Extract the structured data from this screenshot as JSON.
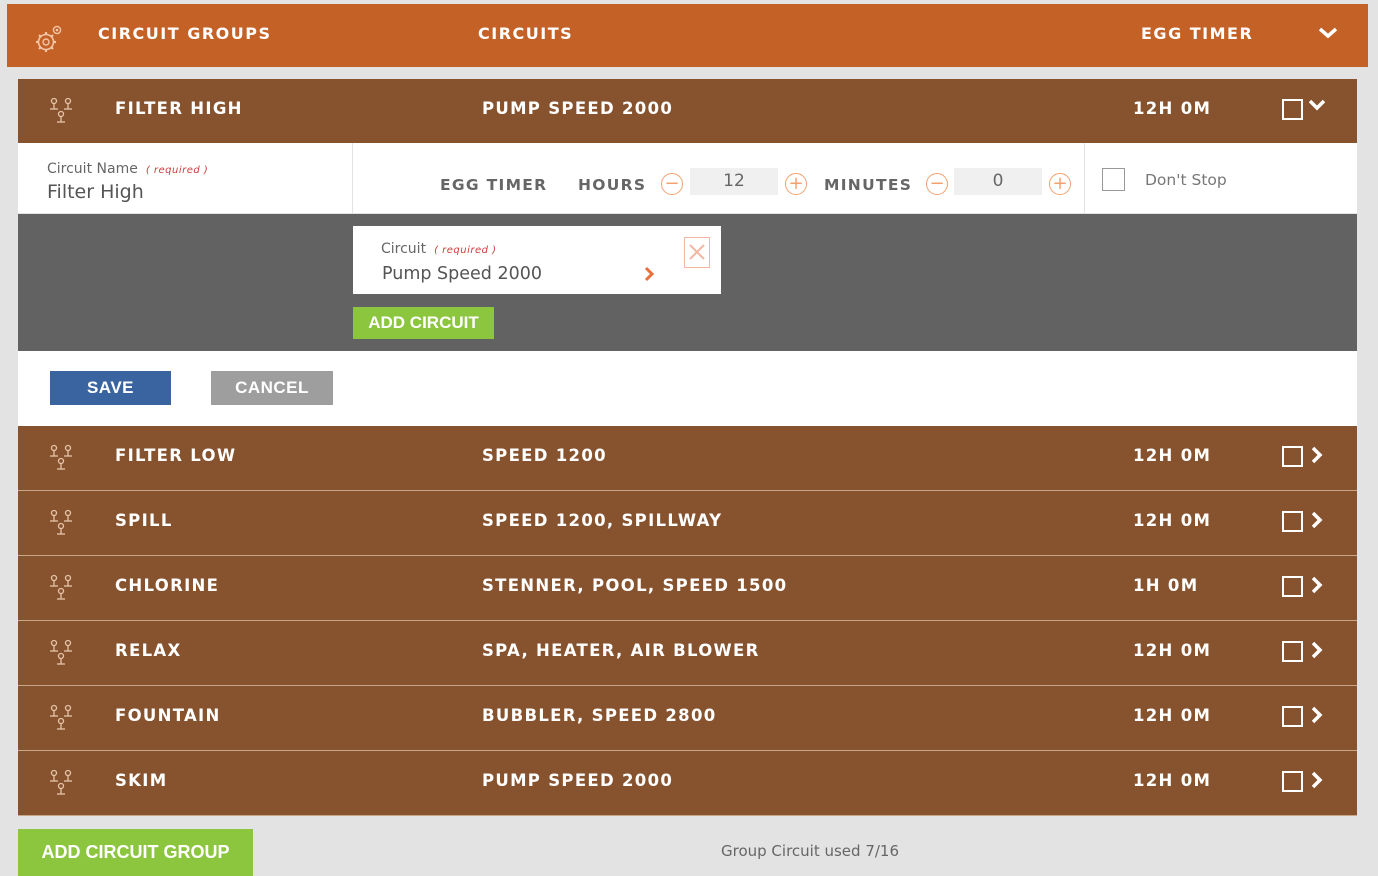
{
  "header": {
    "col_groups": "CIRCUIT GROUPS",
    "col_circuits": "CIRCUITS",
    "col_timer": "EGG TIMER"
  },
  "expanded_group": {
    "name": "FILTER HIGH",
    "circuits": "PUMP SPEED 2000",
    "timer": "12H 0M"
  },
  "editor": {
    "circuit_name_label": "Circuit Name",
    "required_label": "( required )",
    "circuit_name_value": "Filter High",
    "egg_timer_label": "EGG TIMER",
    "hours_label": "HOURS",
    "hours_value": "12",
    "minutes_label": "MINUTES",
    "minutes_value": "0",
    "dont_stop_label": "Don't Stop",
    "circuit_label": "Circuit",
    "circuit_value": "Pump Speed 2000",
    "add_circuit": "ADD CIRCUIT",
    "save": "SAVE",
    "cancel": "CANCEL"
  },
  "groups": [
    {
      "name": "FILTER LOW",
      "circuits": "SPEED 1200",
      "timer": "12H 0M"
    },
    {
      "name": "SPILL",
      "circuits": "SPEED 1200, SPILLWAY",
      "timer": "12H 0M"
    },
    {
      "name": "CHLORINE",
      "circuits": "STENNER, POOL, SPEED 1500",
      "timer": "1H 0M"
    },
    {
      "name": "RELAX",
      "circuits": "SPA, HEATER, AIR BLOWER",
      "timer": "12H 0M"
    },
    {
      "name": "FOUNTAIN",
      "circuits": "BUBBLER, SPEED 2800",
      "timer": "12H 0M"
    },
    {
      "name": "SKIM",
      "circuits": "PUMP SPEED 2000",
      "timer": "12H 0M"
    }
  ],
  "footer": {
    "add_group": "ADD CIRCUIT GROUP",
    "usage": "Group Circuit used 7/16"
  },
  "colors": {
    "header_orange": "#c46126",
    "row_brown": "#87532f",
    "accent_green": "#8cc63f",
    "save_blue": "#3a64a0"
  }
}
